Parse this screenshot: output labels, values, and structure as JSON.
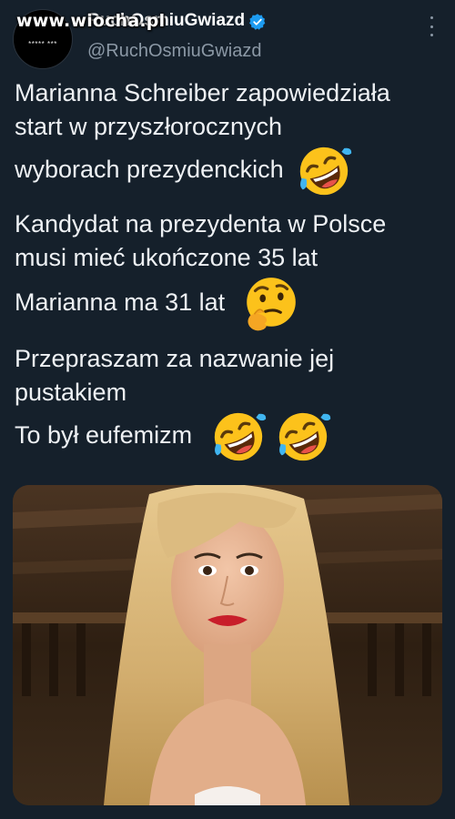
{
  "watermark": "www.wiocha.pl",
  "header": {
    "display_name": "RuchOsmiuGwiazd",
    "handle": "@RuchOsmiuGwiazd",
    "avatar_stars": "***** ***"
  },
  "tweet": {
    "p1": {
      "l1": "Marianna Schreiber zapowiedziała",
      "l2": "start w przyszłorocznych",
      "l3": "wyborach prezydenckich",
      "emoji": "rolling-on-floor-laughing"
    },
    "p2": {
      "l1": "Kandydat na prezydenta w Polsce",
      "l2": "musi mieć ukończone 35 lat",
      "l3": "Marianna ma 31 lat",
      "emoji": "thinking-face"
    },
    "p3": {
      "l1": "Przepraszam za nazwanie jej",
      "l2": "pustakiem",
      "l3": "To był eufemizm",
      "emoji": "rolling-on-floor-laughing"
    }
  },
  "colors": {
    "background": "#15202b",
    "text": "#eef1f4",
    "secondary": "#8b98a5",
    "verified": "#1d9bf0"
  }
}
